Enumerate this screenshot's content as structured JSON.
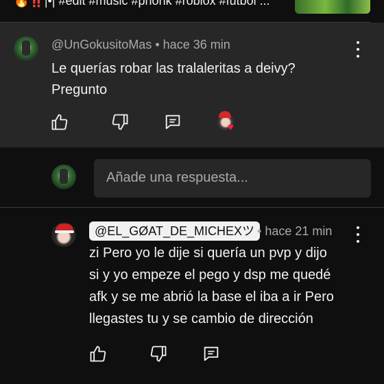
{
  "top_strip": {
    "text": "🔥‼️|•| #edit #music #phonk #roblox #futbol ..."
  },
  "comment": {
    "author": "@UnGokusitoMas",
    "separator": "•",
    "time": "hace 36 min",
    "text_line1": "Le querías robar las tralaleritas a deivy?",
    "text_line2": "Pregunto",
    "actions": [
      "like-icon",
      "dislike-icon",
      "reply-icon"
    ],
    "creator_heart": "heart-icon"
  },
  "reply_box": {
    "placeholder": "Añade una respuesta..."
  },
  "reply": {
    "author": "@EL_GØAT_DE_MICHEXツ",
    "separator": "•",
    "time": "hace 21 min",
    "text_lines": [
      "zi Pero yo le dije si quería un pvp y dijo",
      "si y yo empeze el pego y dsp me quedé",
      "afk y se me abrió la base el iba a ir Pero",
      "llegastes tu y se cambio de dirección"
    ],
    "actions": [
      "like-icon",
      "dislike-icon",
      "reply-icon"
    ]
  },
  "colors": {
    "background": "#0f0f0f",
    "comment_highlight": "#272727",
    "secondary_text": "#aaaaaa",
    "primary_text": "#f1f1f1"
  }
}
